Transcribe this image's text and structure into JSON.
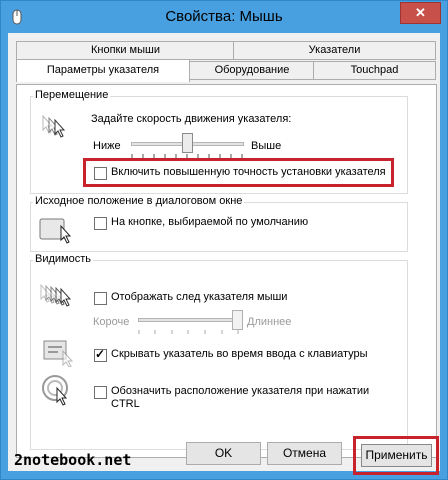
{
  "window": {
    "title": "Свойства: Мышь",
    "close_label": "✕"
  },
  "tabs": {
    "row1": [
      "Кнопки мыши",
      "Указатели"
    ],
    "row2": [
      "Параметры указателя",
      "Оборудование",
      "Touchpad"
    ]
  },
  "movement": {
    "title": "Перемещение",
    "speed_label": "Задайте скорость движения указателя:",
    "slow": "Ниже",
    "fast": "Выше",
    "speed_level": 0.5,
    "precision_label": "Включить повышенную точность установки указателя",
    "precision_checked": false
  },
  "snap": {
    "title": "Исходное положение в диалоговом окне",
    "label": "На кнопке, выбираемой по умолчанию",
    "checked": false
  },
  "visibility": {
    "title": "Видимость",
    "trails_label": "Отображать след указателя мыши",
    "trails_checked": false,
    "short": "Короче",
    "long": "Длиннее",
    "trail_level": 1.0,
    "hide_label": "Скрывать указатель во время ввода с клавиатуры",
    "hide_checked": true,
    "ctrl_label_line1": "Обозначить расположение указателя при нажатии",
    "ctrl_label_line2": "CTRL",
    "ctrl_checked": false
  },
  "buttons": {
    "ok": "OK",
    "cancel": "Отмена",
    "apply": "Применить"
  },
  "watermark": "2notebook.net",
  "colors": {
    "titlebar": "#48a0e0",
    "highlight": "#c8232c",
    "close": "#c7504b"
  }
}
